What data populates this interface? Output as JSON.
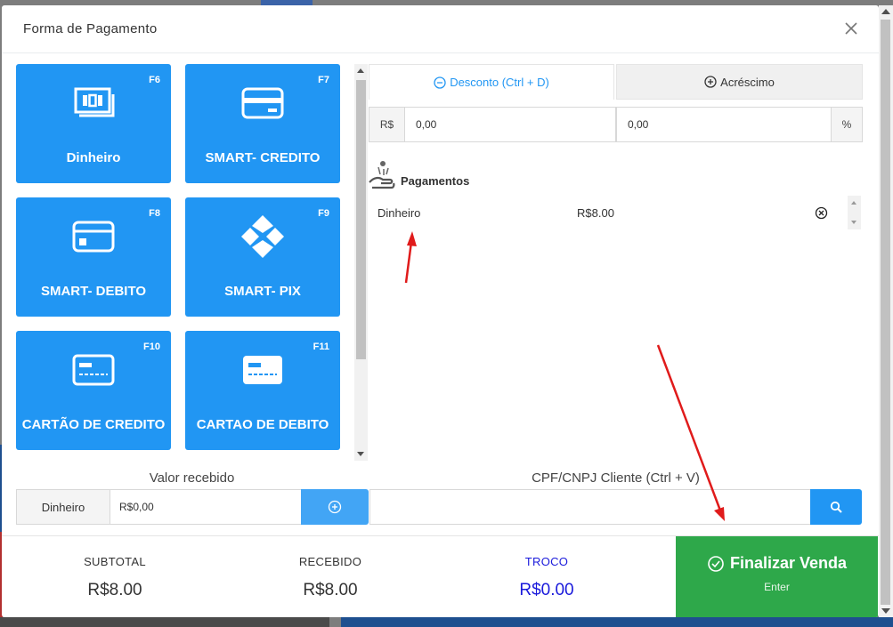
{
  "modal": {
    "title": "Forma de Pagamento",
    "close_icon": "close-icon"
  },
  "tiles": [
    {
      "label": "Dinheiro",
      "key": "F6",
      "icon": "cash-icon"
    },
    {
      "label": "SMART- CREDITO",
      "key": "F7",
      "icon": "credit-card-icon"
    },
    {
      "label": "SMART- DEBITO",
      "key": "F8",
      "icon": "debit-card-icon"
    },
    {
      "label": "SMART- PIX",
      "key": "F9",
      "icon": "pix-icon"
    },
    {
      "label": "CARTÃO DE CREDITO",
      "key": "F10",
      "icon": "card-outline-icon"
    },
    {
      "label": "CARTAO DE DEBITO",
      "key": "F11",
      "icon": "card-filled-icon"
    }
  ],
  "tabs": {
    "discount": "Desconto (Ctrl + D)",
    "addition": "Acréscimo"
  },
  "discount": {
    "currency_label": "R$",
    "currency_value": "0,00",
    "percent_value": "0,00",
    "percent_label": "%"
  },
  "payments": {
    "title": "Pagamentos",
    "items": [
      {
        "method": "Dinheiro",
        "amount": "R$8.00"
      }
    ]
  },
  "received": {
    "label": "Valor recebido",
    "method": "Dinheiro",
    "value": "R$0,00"
  },
  "customer": {
    "label": "CPF/CNPJ Cliente (Ctrl + V)",
    "value": ""
  },
  "totals": {
    "subtotal_label": "SUBTOTAL",
    "subtotal_value": "R$8.00",
    "received_label": "RECEBIDO",
    "received_value": "R$8.00",
    "change_label": "TROCO",
    "change_value": "R$0.00"
  },
  "finalize": {
    "label": "Finalizar Venda",
    "shortcut": "Enter"
  },
  "colors": {
    "tile_blue": "#2196f3",
    "finalize_green": "#2ea84a",
    "change_blue": "#1a1adb",
    "arrow_red": "#e01b1b"
  }
}
